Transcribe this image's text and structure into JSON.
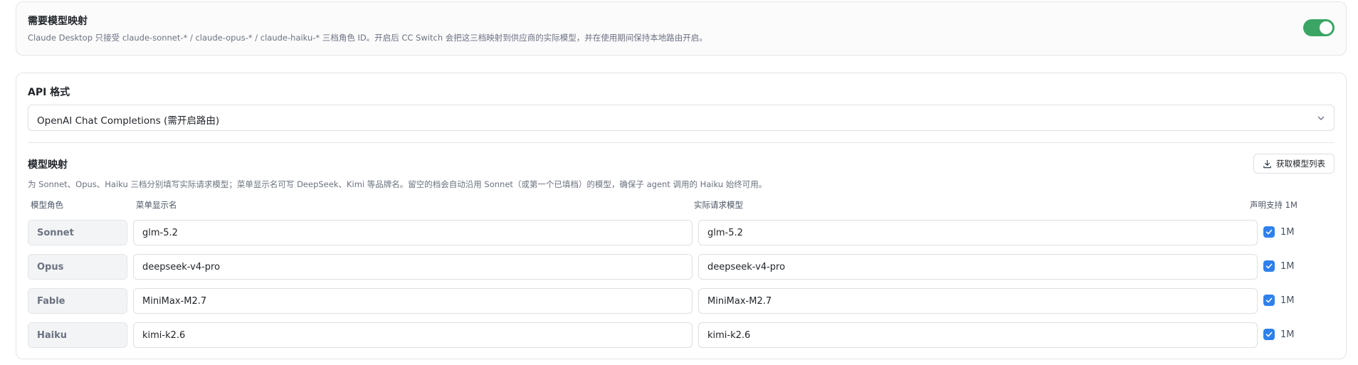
{
  "mapping_toggle": {
    "title": "需要模型映射",
    "description": "Claude Desktop 只接受 claude-sonnet-* / claude-opus-* / claude-haiku-* 三档角色 ID。开启后 CC Switch 会把这三档映射到供应商的实际模型，并在使用期间保持本地路由开启。",
    "enabled": true,
    "accent_color": "#3aa564"
  },
  "api_format": {
    "label": "API 格式",
    "selected": "OpenAI Chat Completions (需开启路由)"
  },
  "model_mapping": {
    "title": "模型映射",
    "fetch_button_label": "获取模型列表",
    "description": "为 Sonnet、Opus、Haiku 三档分别填写实际请求模型；菜单显示名可写 DeepSeek、Kimi 等品牌名。留空的档会自动沿用 Sonnet（或第一个已填档）的模型，确保子 agent 调用的 Haiku 始终可用。",
    "columns": {
      "role": "模型角色",
      "display_name": "菜单显示名",
      "request_model": "实际请求模型",
      "support_1m": "声明支持 1M"
    },
    "rows": [
      {
        "role": "Sonnet",
        "display_name": "glm-5.2",
        "request_model": "glm-5.2",
        "support_1m": true,
        "support_label": "1M"
      },
      {
        "role": "Opus",
        "display_name": "deepseek-v4-pro",
        "request_model": "deepseek-v4-pro",
        "support_1m": true,
        "support_label": "1M"
      },
      {
        "role": "Fable",
        "display_name": "MiniMax-M2.7",
        "request_model": "MiniMax-M2.7",
        "support_1m": true,
        "support_label": "1M"
      },
      {
        "role": "Haiku",
        "display_name": "kimi-k2.6",
        "request_model": "kimi-k2.6",
        "support_1m": true,
        "support_label": "1M"
      }
    ],
    "checkbox_color": "#2f80ed"
  }
}
